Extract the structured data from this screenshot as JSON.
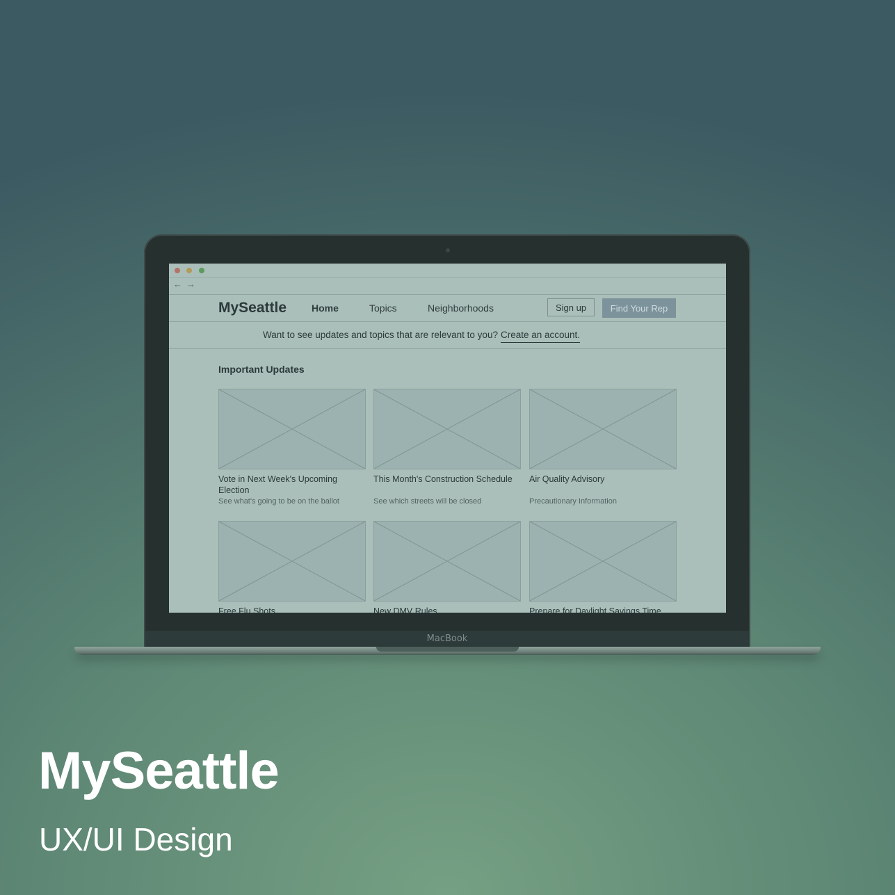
{
  "device": {
    "label": "MacBook"
  },
  "site": {
    "logo": "MySeattle",
    "nav": [
      {
        "label": "Home",
        "active": true
      },
      {
        "label": "Topics",
        "active": false
      },
      {
        "label": "Neighborhoods",
        "active": false
      }
    ],
    "signup_label": "Sign up",
    "find_rep_label": "Find Your Rep"
  },
  "banner": {
    "text": "Want to see updates and topics that are relevant to you?",
    "link": "Create an account."
  },
  "updates": {
    "title": "Important Updates",
    "cards": [
      {
        "title": "Vote in Next Week's Upcoming Election",
        "subtitle": "See what's going to be on the ballot"
      },
      {
        "title": "This Month's Construction Schedule",
        "subtitle": "See which streets will be closed"
      },
      {
        "title": "Air Quality Advisory",
        "subtitle": "Precautionary Information"
      },
      {
        "title": "Free Flu Shots",
        "subtitle": ""
      },
      {
        "title": "New DMV Rules",
        "subtitle": ""
      },
      {
        "title": "Prepare for Daylight Savings Time",
        "subtitle": ""
      }
    ]
  },
  "hero": {
    "title": "MySeattle",
    "subtitle": "UX/UI Design"
  },
  "colors": {
    "screen_bg": "#abbfba",
    "accent_button": "#7c939c",
    "bezel": "#25302f"
  }
}
